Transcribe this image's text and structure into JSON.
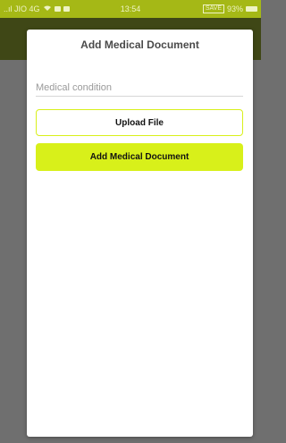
{
  "status_bar": {
    "carrier": "..ıl JIO 4G",
    "time": "13:54",
    "saver_tag": "SAVE",
    "battery": "93%"
  },
  "dialog": {
    "title": "Add Medical Document",
    "field_placeholder": "Medical condition",
    "upload_label": "Upload File",
    "submit_label": "Add Medical Document"
  },
  "colors": {
    "accent": "#d8f01a",
    "status_bar": "#a5b816",
    "app_bar": "#3f4716",
    "overlay": "#6f6f6f"
  },
  "icons": {
    "wifi": "wifi-icon",
    "notification": "notification-icon",
    "gallery": "gallery-icon",
    "battery": "battery-icon"
  }
}
